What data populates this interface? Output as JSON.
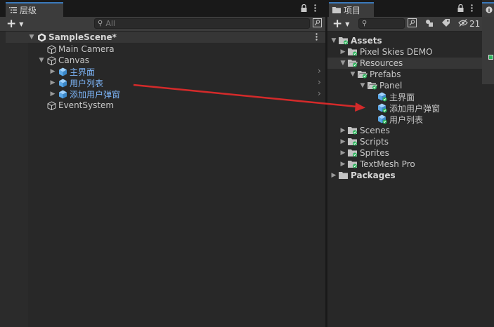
{
  "hierarchy": {
    "tab_label": "层级",
    "search_placeholder": "All",
    "scene_name": "SampleScene*",
    "items": [
      {
        "label": "Main Camera"
      },
      {
        "label": "Canvas"
      },
      {
        "label": "主界面"
      },
      {
        "label": "用户列表"
      },
      {
        "label": "添加用户弹窗"
      },
      {
        "label": "EventSystem"
      }
    ]
  },
  "project": {
    "tab_label": "项目",
    "hidden_count": "21",
    "tree": [
      {
        "label": "Assets"
      },
      {
        "label": "Pixel Skies DEMO"
      },
      {
        "label": "Resources"
      },
      {
        "label": "Prefabs"
      },
      {
        "label": "Panel"
      },
      {
        "label": "主界面"
      },
      {
        "label": "添加用户弹窗"
      },
      {
        "label": "用户列表"
      },
      {
        "label": "Scenes"
      },
      {
        "label": "Scripts"
      },
      {
        "label": "Sprites"
      },
      {
        "label": "TextMesh Pro"
      },
      {
        "label": "Packages"
      }
    ]
  },
  "colors": {
    "accent": "#3a79bb",
    "prefab_text": "#7cb3f5",
    "arrow": "#d42a2a"
  },
  "icons": [
    "list-icon",
    "lock-icon",
    "kebab-menu-icon",
    "plus-icon",
    "search-icon",
    "unity-scene-icon",
    "cube-icon",
    "prefab-icon",
    "folder-icon",
    "chevron-right-icon",
    "tag-icon",
    "eye-off-icon",
    "info-icon"
  ]
}
